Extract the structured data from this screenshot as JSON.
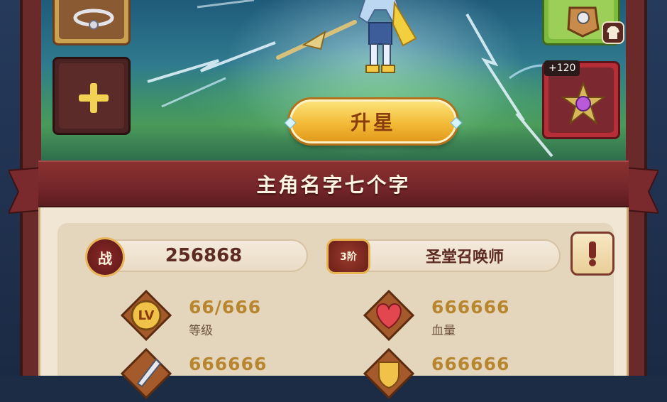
{
  "hero": {
    "upgrade_label": "升星",
    "name": "主角名字七个字",
    "equip_bonus": "+120"
  },
  "stats": {
    "power": {
      "icon_text": "战",
      "value": "256868"
    },
    "rank": {
      "badge_text": "3阶",
      "class_name": "圣堂召唤师"
    },
    "level": {
      "icon_text": "LV",
      "value": "66/666",
      "label": "等级"
    },
    "hp": {
      "value": "666666",
      "label": "血量"
    },
    "attack": {
      "value": "666666"
    },
    "defense": {
      "value": "666666"
    }
  },
  "icons": {
    "add_slot": "plus-icon",
    "info": "exclamation-icon",
    "skin": "shirt-icon",
    "necklace": "necklace-icon",
    "gauntlet": "gauntlet-icon",
    "emblem": "star-emblem-icon",
    "power": "flame-badge-icon",
    "level": "level-badge-icon",
    "hp": "heart-icon",
    "attack": "sword-icon",
    "defense": "shield-icon"
  },
  "colors": {
    "frame": "#6b2a2a",
    "banner": "#7c2b2d",
    "panel": "#f1e6d3",
    "gold_text": "#b7862f",
    "upgrade_button": "#f3bb37"
  }
}
